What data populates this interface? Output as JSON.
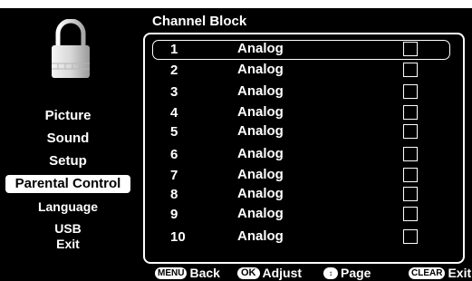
{
  "panel": {
    "title": "Channel Block"
  },
  "menu": {
    "items": [
      {
        "label": "Picture",
        "selected": false
      },
      {
        "label": "Sound",
        "selected": false
      },
      {
        "label": "Setup",
        "selected": false
      },
      {
        "label": "Parental Control",
        "selected": true
      },
      {
        "label": "Language",
        "selected": false
      },
      {
        "label": "USB",
        "selected": false
      },
      {
        "label": "Exit",
        "selected": false
      }
    ]
  },
  "channels": [
    {
      "number": "1",
      "type": "Analog",
      "blocked": false
    },
    {
      "number": "2",
      "type": "Analog",
      "blocked": false
    },
    {
      "number": "3",
      "type": "Analog",
      "blocked": false
    },
    {
      "number": "4",
      "type": "Analog",
      "blocked": false
    },
    {
      "number": "5",
      "type": "Analog",
      "blocked": false
    },
    {
      "number": "6",
      "type": "Analog",
      "blocked": false
    },
    {
      "number": "7",
      "type": "Analog",
      "blocked": false
    },
    {
      "number": "8",
      "type": "Analog",
      "blocked": false
    },
    {
      "number": "9",
      "type": "Analog",
      "blocked": false
    },
    {
      "number": "10",
      "type": "Analog",
      "blocked": false
    }
  ],
  "footer": {
    "menu_key": "MENU",
    "back_label": "Back",
    "ok_key": "OK",
    "adjust_label": "Adjust",
    "page_label": "Page",
    "clear_key": "CLEAR",
    "exit_label": "Exit"
  },
  "icons": {
    "lock": "padlock-icon",
    "updown": "up-down-arrows-icon"
  }
}
